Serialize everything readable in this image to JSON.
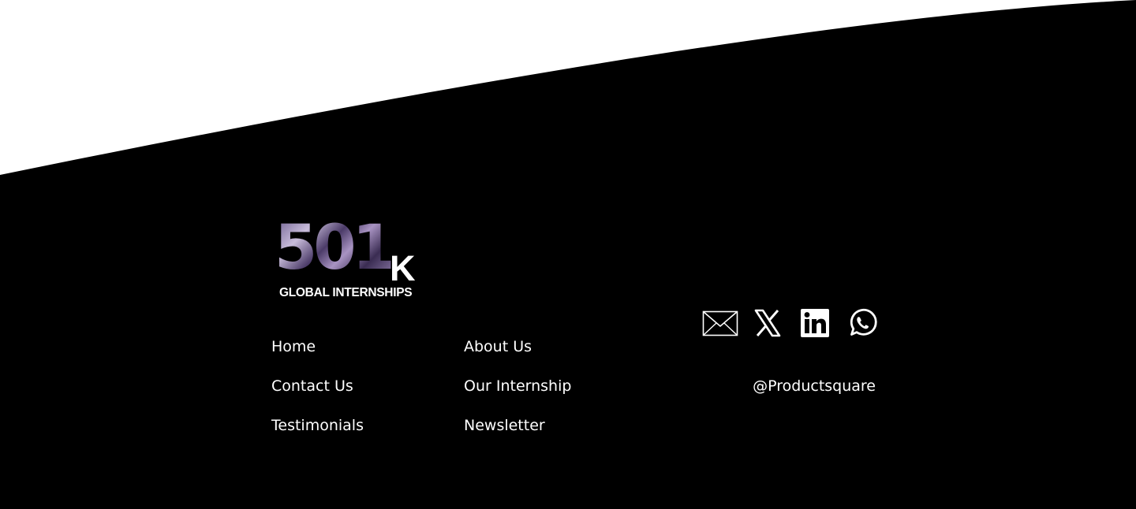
{
  "logo": {
    "number": "501",
    "suffix": "K",
    "tagline": "GLOBAL INTERNSHIPS"
  },
  "nav": {
    "home": "Home",
    "contact_us": "Contact Us",
    "testimonials": "Testimonials",
    "about_us": "About Us",
    "our_internship": "Our Internship",
    "newsletter": "Newsletter"
  },
  "social": {
    "icons": [
      "mail-icon",
      "x-icon",
      "linkedin-icon",
      "whatsapp-icon"
    ],
    "handle": "@Productsquare"
  },
  "colors": {
    "footer_background": "#000000",
    "top_background": "#ffffff",
    "text": "#ffffff"
  }
}
